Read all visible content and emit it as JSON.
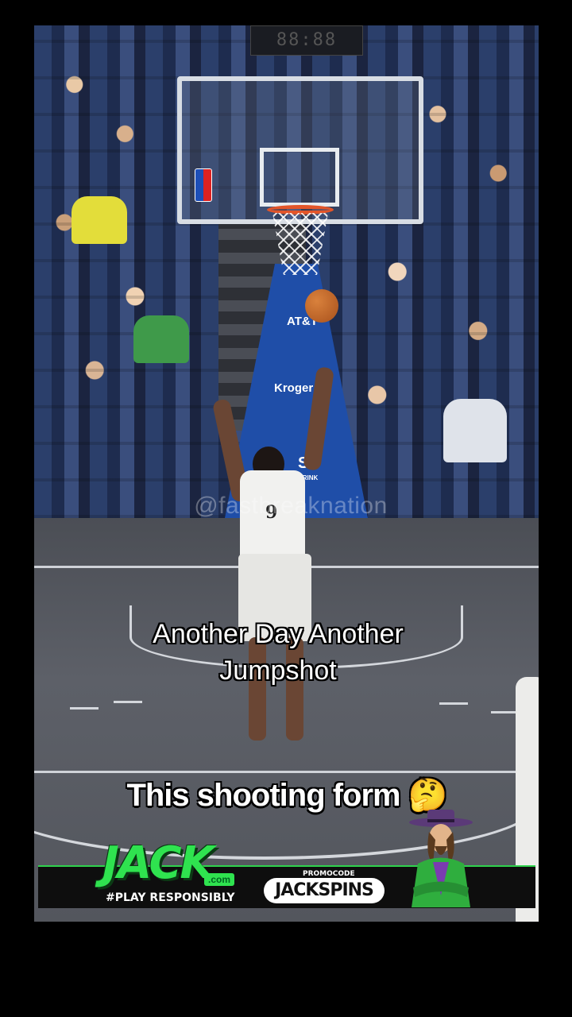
{
  "video": {
    "watermark": "@fastbreaknation",
    "shot_clock": "88:88",
    "jersey_number": "9",
    "stanchion_text": [
      "AT&T",
      "Kroger",
      "SE",
      "DRINK"
    ]
  },
  "captions": {
    "main": "Another Day Another Jumpshot",
    "sub": "This shooting form 🤔"
  },
  "ad": {
    "brand": "JACK",
    "brand_suffix": ".com",
    "tagline": "#PLAY RESPONSIBLY",
    "promo_label": "PROMOCODE",
    "promo_code": "JACKSPINS",
    "brand_color": "#2fe34f"
  }
}
